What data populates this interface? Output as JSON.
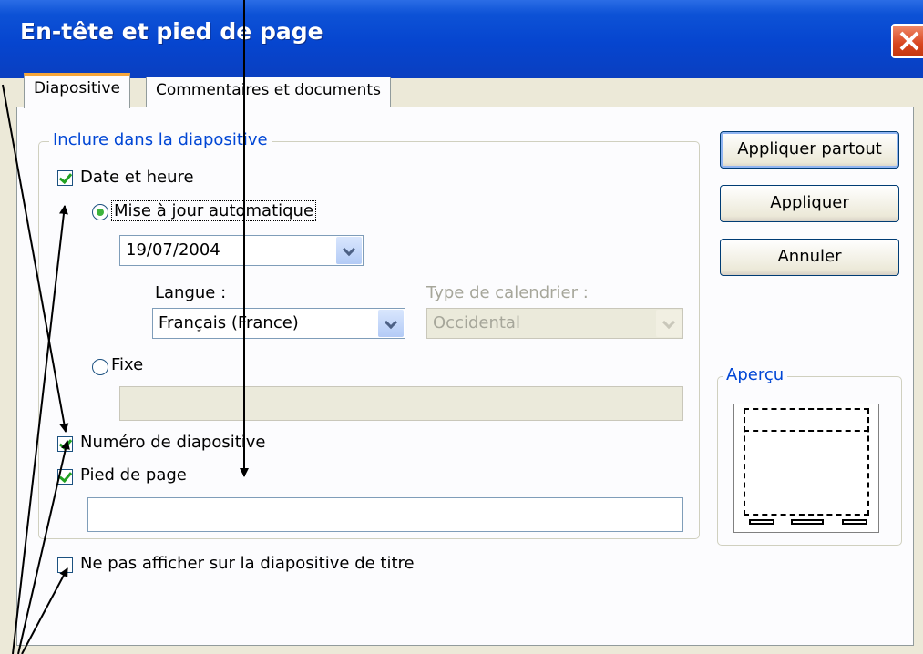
{
  "window": {
    "title": "En-tête et pied de page"
  },
  "tabs": [
    {
      "label": "Diapositive",
      "active": true
    },
    {
      "label": "Commentaires et documents",
      "active": false
    }
  ],
  "group": {
    "title": "Inclure dans la diapositive",
    "date_time": {
      "label": "Date et heure",
      "checked": true
    },
    "auto_update": {
      "label": "Mise à jour automatique",
      "selected": true
    },
    "date_format": {
      "value": "19/07/2004"
    },
    "language": {
      "label": "Langue :",
      "value": "Français (France)"
    },
    "calendar": {
      "label": "Type de calendrier :",
      "value": "Occidental",
      "enabled": false
    },
    "fixed": {
      "label": "Fixe",
      "selected": false,
      "value": ""
    },
    "slide_number": {
      "label": "Numéro de diapositive",
      "checked": true
    },
    "footer": {
      "label": "Pied de page",
      "checked": true,
      "value": ""
    }
  },
  "hide_on_title": {
    "label": "Ne pas afficher sur la diapositive de titre",
    "checked": false
  },
  "buttons": {
    "apply_all": "Appliquer partout",
    "apply": "Appliquer",
    "cancel": "Annuler"
  },
  "preview": {
    "title": "Aperçu"
  },
  "colors": {
    "titlebar": "#0645cf",
    "group_title": "#0046d5",
    "check": "#21a121",
    "close": "#d8451e"
  }
}
